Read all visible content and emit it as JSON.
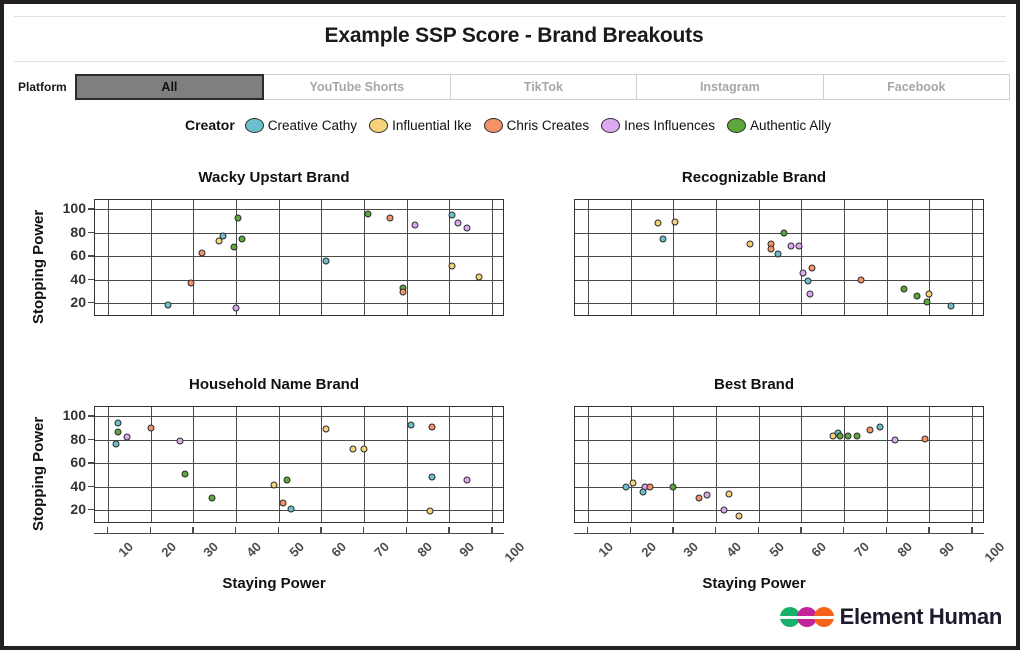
{
  "title": "Example SSP Score - Brand Breakouts",
  "platform_filter": {
    "label": "Platform",
    "selected": "All",
    "options": [
      "All",
      "YouTube Shorts",
      "TikTok",
      "Instagram",
      "Facebook"
    ]
  },
  "creator_legend": {
    "title": "Creator",
    "items": [
      {
        "label": "Creative Cathy",
        "color": "#6cbfcb"
      },
      {
        "label": "Influential Ike",
        "color": "#f6d37a"
      },
      {
        "label": "Chris Creates",
        "color": "#f4926a"
      },
      {
        "label": "Ines Influences",
        "color": "#dda9f0"
      },
      {
        "label": "Authentic Ally",
        "color": "#5da83d"
      }
    ]
  },
  "axes": {
    "xlabel": "Staying Power",
    "ylabel": "Stopping Power",
    "xticks": [
      10,
      20,
      30,
      40,
      50,
      60,
      70,
      80,
      90,
      100
    ],
    "yticks": [
      20,
      40,
      60,
      80,
      100
    ],
    "xlim": [
      7,
      103
    ],
    "ylim": [
      8,
      108
    ]
  },
  "footer": {
    "brand": "Element Human"
  },
  "chart_data": [
    {
      "type": "scatter",
      "title": "Wacky Upstart Brand",
      "xlabel": "Staying Power",
      "ylabel": "Stopping Power",
      "xlim": [
        7,
        103
      ],
      "ylim": [
        8,
        108
      ],
      "xticks": [
        10,
        20,
        30,
        40,
        50,
        60,
        70,
        80,
        90,
        100
      ],
      "yticks": [
        20,
        40,
        60,
        80,
        100
      ],
      "grid": true,
      "points": [
        {
          "x": 24,
          "y": 18,
          "creator": "Creative Cathy",
          "color": "#6cbfcb"
        },
        {
          "x": 29.5,
          "y": 37,
          "creator": "Chris Creates",
          "color": "#f4926a"
        },
        {
          "x": 32,
          "y": 63,
          "creator": "Chris Creates",
          "color": "#f4926a"
        },
        {
          "x": 36,
          "y": 73,
          "creator": "Influential Ike",
          "color": "#f6d37a"
        },
        {
          "x": 37,
          "y": 77,
          "creator": "Creative Cathy",
          "color": "#6cbfcb"
        },
        {
          "x": 40.5,
          "y": 93,
          "creator": "Authentic Ally",
          "color": "#5da83d"
        },
        {
          "x": 39.5,
          "y": 68,
          "creator": "Authentic Ally",
          "color": "#5da83d"
        },
        {
          "x": 41.5,
          "y": 75,
          "creator": "Authentic Ally",
          "color": "#5da83d"
        },
        {
          "x": 40,
          "y": 16,
          "creator": "Ines Influences",
          "color": "#dda9f0"
        },
        {
          "x": 61,
          "y": 56,
          "creator": "Creative Cathy",
          "color": "#6cbfcb"
        },
        {
          "x": 71,
          "y": 96,
          "creator": "Authentic Ally",
          "color": "#5da83d"
        },
        {
          "x": 76,
          "y": 93,
          "creator": "Chris Creates",
          "color": "#f4926a"
        },
        {
          "x": 79,
          "y": 33,
          "creator": "Authentic Ally",
          "color": "#5da83d"
        },
        {
          "x": 79,
          "y": 29,
          "creator": "Chris Creates",
          "color": "#f4926a"
        },
        {
          "x": 82,
          "y": 87,
          "creator": "Ines Influences",
          "color": "#dda9f0"
        },
        {
          "x": 90.5,
          "y": 95,
          "creator": "Creative Cathy",
          "color": "#6cbfcb"
        },
        {
          "x": 92,
          "y": 88,
          "creator": "Ines Influences",
          "color": "#dda9f0"
        },
        {
          "x": 94,
          "y": 84,
          "creator": "Ines Influences",
          "color": "#dda9f0"
        },
        {
          "x": 90.5,
          "y": 52,
          "creator": "Influential Ike",
          "color": "#f6d37a"
        },
        {
          "x": 97,
          "y": 42,
          "creator": "Influential Ike",
          "color": "#f6d37a"
        }
      ]
    },
    {
      "type": "scatter",
      "title": "Recognizable Brand",
      "xlabel": "Staying Power",
      "ylabel": "Stopping Power",
      "xlim": [
        7,
        103
      ],
      "ylim": [
        8,
        108
      ],
      "xticks": [
        10,
        20,
        30,
        40,
        50,
        60,
        70,
        80,
        90,
        100
      ],
      "yticks": [
        20,
        40,
        60,
        80,
        100
      ],
      "grid": true,
      "points": [
        {
          "x": 26.5,
          "y": 88,
          "creator": "Influential Ike",
          "color": "#f6d37a"
        },
        {
          "x": 30.5,
          "y": 89,
          "creator": "Influential Ike",
          "color": "#f6d37a"
        },
        {
          "x": 27.5,
          "y": 75,
          "creator": "Creative Cathy",
          "color": "#6cbfcb"
        },
        {
          "x": 48,
          "y": 70,
          "creator": "Influential Ike",
          "color": "#f6d37a"
        },
        {
          "x": 53,
          "y": 70,
          "creator": "Chris Creates",
          "color": "#f4926a"
        },
        {
          "x": 53,
          "y": 66,
          "creator": "Chris Creates",
          "color": "#f4926a"
        },
        {
          "x": 56,
          "y": 80,
          "creator": "Authentic Ally",
          "color": "#5da83d"
        },
        {
          "x": 54.5,
          "y": 62,
          "creator": "Creative Cathy",
          "color": "#6cbfcb"
        },
        {
          "x": 57.5,
          "y": 69,
          "creator": "Ines Influences",
          "color": "#dda9f0"
        },
        {
          "x": 59.5,
          "y": 69,
          "creator": "Ines Influences",
          "color": "#dda9f0"
        },
        {
          "x": 60.5,
          "y": 46,
          "creator": "Ines Influences",
          "color": "#dda9f0"
        },
        {
          "x": 62.5,
          "y": 50,
          "creator": "Chris Creates",
          "color": "#f4926a"
        },
        {
          "x": 61.5,
          "y": 39,
          "creator": "Creative Cathy",
          "color": "#6cbfcb"
        },
        {
          "x": 62,
          "y": 28,
          "creator": "Ines Influences",
          "color": "#dda9f0"
        },
        {
          "x": 74,
          "y": 40,
          "creator": "Chris Creates",
          "color": "#f4926a"
        },
        {
          "x": 84,
          "y": 32,
          "creator": "Authentic Ally",
          "color": "#5da83d"
        },
        {
          "x": 87,
          "y": 26,
          "creator": "Authentic Ally",
          "color": "#5da83d"
        },
        {
          "x": 90,
          "y": 28,
          "creator": "Influential Ike",
          "color": "#f6d37a"
        },
        {
          "x": 89.5,
          "y": 21,
          "creator": "Authentic Ally",
          "color": "#5da83d"
        },
        {
          "x": 95,
          "y": 17,
          "creator": "Creative Cathy",
          "color": "#6cbfcb"
        }
      ]
    },
    {
      "type": "scatter",
      "title": "Household Name Brand",
      "xlabel": "Staying Power",
      "ylabel": "Stopping Power",
      "xlim": [
        7,
        103
      ],
      "ylim": [
        8,
        108
      ],
      "xticks": [
        10,
        20,
        30,
        40,
        50,
        60,
        70,
        80,
        90,
        100
      ],
      "yticks": [
        20,
        40,
        60,
        80,
        100
      ],
      "grid": true,
      "points": [
        {
          "x": 12.5,
          "y": 94,
          "creator": "Creative Cathy",
          "color": "#6cbfcb"
        },
        {
          "x": 12.5,
          "y": 87,
          "creator": "Authentic Ally",
          "color": "#5da83d"
        },
        {
          "x": 14.5,
          "y": 82,
          "creator": "Ines Influences",
          "color": "#dda9f0"
        },
        {
          "x": 12,
          "y": 76,
          "creator": "Creative Cathy",
          "color": "#6cbfcb"
        },
        {
          "x": 20,
          "y": 90,
          "creator": "Chris Creates",
          "color": "#f4926a"
        },
        {
          "x": 27,
          "y": 79,
          "creator": "Ines Influences",
          "color": "#dda9f0"
        },
        {
          "x": 28,
          "y": 51,
          "creator": "Authentic Ally",
          "color": "#5da83d"
        },
        {
          "x": 34.5,
          "y": 30,
          "creator": "Authentic Ally",
          "color": "#5da83d"
        },
        {
          "x": 49,
          "y": 41,
          "creator": "Influential Ike",
          "color": "#f6d37a"
        },
        {
          "x": 52,
          "y": 46,
          "creator": "Authentic Ally",
          "color": "#5da83d"
        },
        {
          "x": 51,
          "y": 26,
          "creator": "Chris Creates",
          "color": "#f4926a"
        },
        {
          "x": 53,
          "y": 21,
          "creator": "Creative Cathy",
          "color": "#6cbfcb"
        },
        {
          "x": 61,
          "y": 89,
          "creator": "Influential Ike",
          "color": "#f6d37a"
        },
        {
          "x": 67.5,
          "y": 72,
          "creator": "Influential Ike",
          "color": "#f6d37a"
        },
        {
          "x": 70,
          "y": 72,
          "creator": "Influential Ike",
          "color": "#f6d37a"
        },
        {
          "x": 81,
          "y": 93,
          "creator": "Creative Cathy",
          "color": "#6cbfcb"
        },
        {
          "x": 86,
          "y": 91,
          "creator": "Chris Creates",
          "color": "#f4926a"
        },
        {
          "x": 86,
          "y": 48,
          "creator": "Creative Cathy",
          "color": "#6cbfcb"
        },
        {
          "x": 85.5,
          "y": 19,
          "creator": "Influential Ike",
          "color": "#f6d37a"
        },
        {
          "x": 94,
          "y": 46,
          "creator": "Ines Influences",
          "color": "#dda9f0"
        }
      ]
    },
    {
      "type": "scatter",
      "title": "Best Brand",
      "xlabel": "Staying Power",
      "ylabel": "Stopping Power",
      "xlim": [
        7,
        103
      ],
      "ylim": [
        8,
        108
      ],
      "xticks": [
        10,
        20,
        30,
        40,
        50,
        60,
        70,
        80,
        90,
        100
      ],
      "yticks": [
        20,
        40,
        60,
        80,
        100
      ],
      "grid": true,
      "points": [
        {
          "x": 19,
          "y": 40,
          "creator": "Creative Cathy",
          "color": "#6cbfcb"
        },
        {
          "x": 20.5,
          "y": 43,
          "creator": "Influential Ike",
          "color": "#f6d37a"
        },
        {
          "x": 23.5,
          "y": 40,
          "creator": "Ines Influences",
          "color": "#dda9f0"
        },
        {
          "x": 24.5,
          "y": 40,
          "creator": "Chris Creates",
          "color": "#f4926a"
        },
        {
          "x": 23,
          "y": 35,
          "creator": "Creative Cathy",
          "color": "#6cbfcb"
        },
        {
          "x": 30,
          "y": 40,
          "creator": "Authentic Ally",
          "color": "#5da83d"
        },
        {
          "x": 36,
          "y": 30,
          "creator": "Chris Creates",
          "color": "#f4926a"
        },
        {
          "x": 38,
          "y": 33,
          "creator": "Ines Influences",
          "color": "#dda9f0"
        },
        {
          "x": 42,
          "y": 20,
          "creator": "Ines Influences",
          "color": "#dda9f0"
        },
        {
          "x": 43,
          "y": 34,
          "creator": "Influential Ike",
          "color": "#f6d37a"
        },
        {
          "x": 45.5,
          "y": 15,
          "creator": "Influential Ike",
          "color": "#f6d37a"
        },
        {
          "x": 67.5,
          "y": 83,
          "creator": "Influential Ike",
          "color": "#f6d37a"
        },
        {
          "x": 68.5,
          "y": 86,
          "creator": "Creative Cathy",
          "color": "#6cbfcb"
        },
        {
          "x": 69,
          "y": 83,
          "creator": "Authentic Ally",
          "color": "#5da83d"
        },
        {
          "x": 71,
          "y": 83,
          "creator": "Authentic Ally",
          "color": "#5da83d"
        },
        {
          "x": 73,
          "y": 83,
          "creator": "Authentic Ally",
          "color": "#5da83d"
        },
        {
          "x": 76,
          "y": 88,
          "creator": "Chris Creates",
          "color": "#f4926a"
        },
        {
          "x": 78.5,
          "y": 91,
          "creator": "Creative Cathy",
          "color": "#6cbfcb"
        },
        {
          "x": 82,
          "y": 80,
          "creator": "Ines Influences",
          "color": "#dda9f0"
        },
        {
          "x": 89,
          "y": 81,
          "creator": "Chris Creates",
          "color": "#f4926a"
        }
      ]
    }
  ],
  "logo_colors": [
    "#17b26a",
    "#c4249a",
    "#f5631a"
  ]
}
